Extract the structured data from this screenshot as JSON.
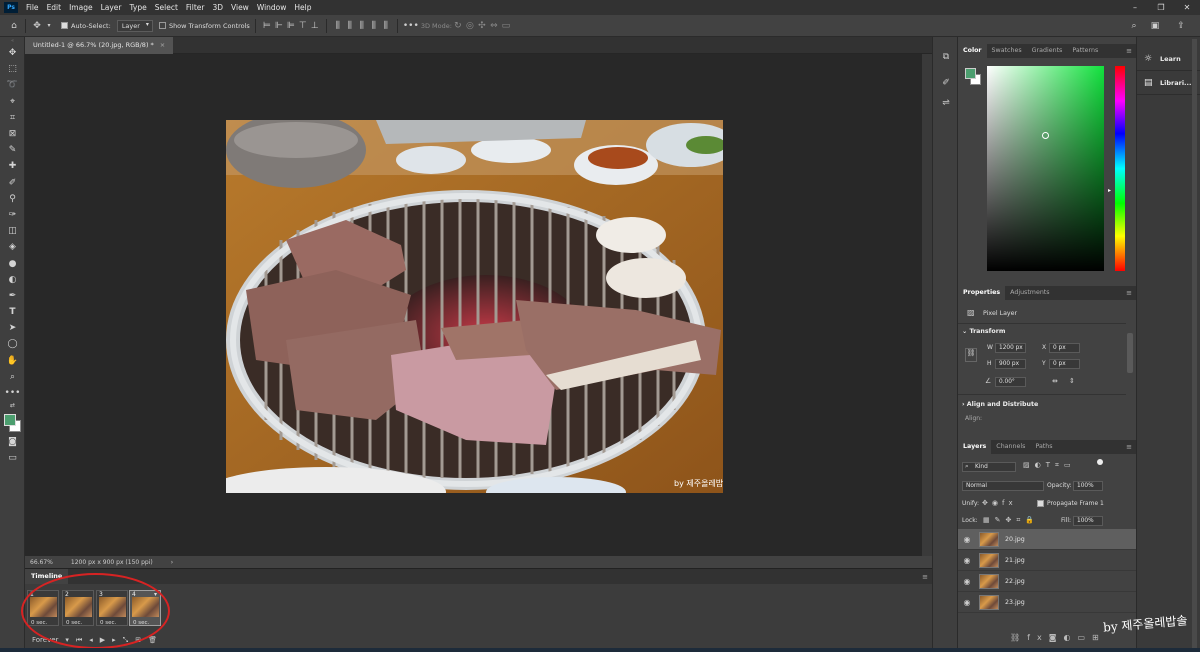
{
  "app": {
    "logo": "Ps",
    "menu": [
      "File",
      "Edit",
      "Image",
      "Layer",
      "Type",
      "Select",
      "Filter",
      "3D",
      "View",
      "Window",
      "Help"
    ],
    "window_controls": [
      "–",
      "❐",
      "✕"
    ]
  },
  "options_bar": {
    "auto_select_label": "Auto-Select:",
    "auto_select_target": "Layer",
    "show_transform_label": "Show Transform Controls",
    "mode_3d_label": "3D Mode:"
  },
  "document": {
    "tab_title": "Untitled-1 @ 66.7% (20.jpg, RGB/8) *",
    "close_glyph": "×",
    "zoom": "66.67%",
    "info": "1200 px x 900 px (150 ppi)"
  },
  "timeline": {
    "tab_label": "Timeline",
    "frames": [
      {
        "num": "1",
        "delay": "0 sec."
      },
      {
        "num": "2",
        "delay": "0 sec."
      },
      {
        "num": "3",
        "delay": "0 sec."
      },
      {
        "num": "4",
        "delay": "0 sec."
      }
    ],
    "loop": "Forever"
  },
  "color_panel": {
    "tabs": [
      "Color",
      "Swatches",
      "Gradients",
      "Patterns"
    ],
    "foreground": "#4c9e6f",
    "background": "#ffffff",
    "hue": "#12e13d"
  },
  "properties_panel": {
    "tabs": [
      "Properties",
      "Adjustments"
    ],
    "type_label": "Pixel Layer",
    "transform_label": "Transform",
    "w_label": "W",
    "w_value": "1200 px",
    "h_label": "H",
    "h_value": "900 px",
    "x_label": "X",
    "x_value": "0 px",
    "y_label": "Y",
    "y_value": "0 px",
    "angle_value": "0.00°",
    "align_label": "Align and Distribute",
    "align_sub": "Align:"
  },
  "layers_panel": {
    "tabs": [
      "Layers",
      "Channels",
      "Paths"
    ],
    "filter_kind": "Kind",
    "blend_mode": "Normal",
    "opacity_label": "Opacity:",
    "opacity_value": "100%",
    "unify_label": "Unify:",
    "propagate_label": "Propagate Frame 1",
    "lock_label": "Lock:",
    "fill_label": "Fill:",
    "fill_value": "100%",
    "layers": [
      {
        "name": "20.jpg",
        "selected": true
      },
      {
        "name": "21.jpg",
        "selected": false
      },
      {
        "name": "22.jpg",
        "selected": false
      },
      {
        "name": "23.jpg",
        "selected": false
      }
    ]
  },
  "learn_panel": {
    "items": [
      {
        "icon": "lightbulb-icon",
        "label": "Learn"
      },
      {
        "icon": "library-icon",
        "label": "Librari..."
      }
    ]
  },
  "watermark": {
    "photo_text": "by 제주올레밥솔",
    "screen_text": "by 제주올레밥솔"
  }
}
